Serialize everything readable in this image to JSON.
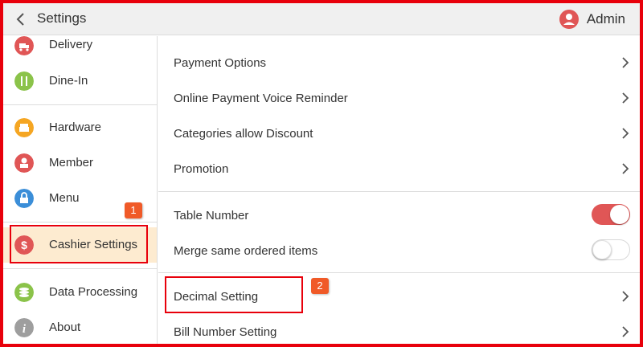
{
  "header": {
    "title": "Settings",
    "user_name": "Admin",
    "back_icon": "back-icon",
    "avatar_icon": "avatar-icon"
  },
  "sidebar": {
    "items": [
      {
        "label": "Delivery",
        "icon": "delivery-icon",
        "color": "#e05656"
      },
      {
        "label": "Dine-In",
        "icon": "dine-in-icon",
        "color": "#8bc34a"
      },
      {
        "label": "Hardware",
        "icon": "hardware-icon",
        "color": "#f5a623"
      },
      {
        "label": "Member",
        "icon": "member-icon",
        "color": "#e05656"
      },
      {
        "label": "Menu",
        "icon": "menu-icon",
        "color": "#3b8ed8"
      },
      {
        "label": "Cashier Settings",
        "icon": "cashier-icon",
        "color": "#e05656",
        "active": true
      },
      {
        "label": "Data Processing",
        "icon": "data-processing-icon",
        "color": "#8bc34a"
      },
      {
        "label": "About",
        "icon": "about-icon",
        "color": "#9e9e9e"
      }
    ],
    "active_highlight_color": "#fdebd0",
    "badge": "1"
  },
  "main": {
    "rows": [
      {
        "label": "Payment Options",
        "type": "chevron"
      },
      {
        "label": "Online Payment Voice Reminder",
        "type": "chevron"
      },
      {
        "label": "Categories allow Discount",
        "type": "chevron"
      },
      {
        "label": "Promotion",
        "type": "chevron"
      },
      {
        "label": "Table Number",
        "type": "toggle",
        "value": true
      },
      {
        "label": "Merge same ordered items",
        "type": "toggle",
        "value": false
      },
      {
        "label": "Decimal Setting",
        "type": "chevron"
      },
      {
        "label": "Bill Number Setting",
        "type": "chevron"
      }
    ],
    "badge": "2"
  },
  "colors": {
    "annotation_red": "#e8000b",
    "badge_orange": "#f05a28",
    "toggle_on": "#e05656"
  }
}
